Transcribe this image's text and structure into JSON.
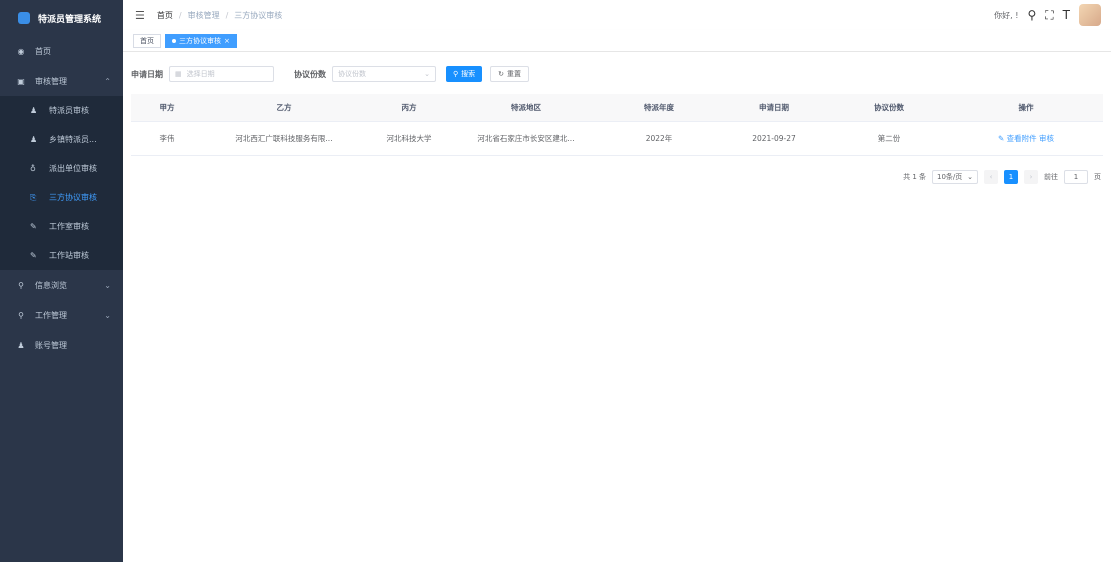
{
  "app": {
    "title": "特派员管理系统"
  },
  "sidebar": {
    "items": [
      {
        "label": "首页",
        "icon": "dashboard-icon"
      },
      {
        "label": "审核管理",
        "icon": "audit-icon",
        "arrow": "⌃"
      },
      {
        "label": "信息浏览",
        "icon": "browse-icon",
        "arrow": "⌄"
      },
      {
        "label": "工作管理",
        "icon": "work-icon",
        "arrow": "⌄"
      },
      {
        "label": "账号管理",
        "icon": "user-icon"
      }
    ],
    "sub_items": [
      {
        "label": "特派员审核",
        "icon": "user-icon"
      },
      {
        "label": "乡镇特派员...",
        "icon": "user-icon"
      },
      {
        "label": "派出单位审核",
        "icon": "org-icon"
      },
      {
        "label": "三方协议审核",
        "icon": "doc-icon"
      },
      {
        "label": "工作室审核",
        "icon": "edit-icon"
      },
      {
        "label": "工作站审核",
        "icon": "edit-icon"
      }
    ]
  },
  "header": {
    "breadcrumb": [
      "首页",
      "审核管理",
      "三方协议审核"
    ],
    "greeting": "你好, !"
  },
  "tags": {
    "home": "首页",
    "active": "三方协议审核"
  },
  "search": {
    "date_label": "申请日期",
    "date_placeholder": "选择日期",
    "copies_label": "协议份数",
    "copies_placeholder": "协议份数",
    "search_btn": "搜索",
    "reset_btn": "重置"
  },
  "table": {
    "headers": [
      "甲方",
      "乙方",
      "丙方",
      "特派地区",
      "特派年度",
      "申请日期",
      "协议份数",
      "操作"
    ],
    "rows": [
      {
        "party_a": "李伟",
        "party_b": "河北西汇广联科技服务有限...",
        "party_c": "河北科技大学",
        "region": "河北省石家庄市长安区建北...",
        "year": "2022年",
        "date": "2021-09-27",
        "copies": "第二份",
        "view": "查看附件",
        "audit": "审核"
      }
    ]
  },
  "pagination": {
    "total": "共 1 条",
    "page_size": "10条/页",
    "current": "1",
    "goto_label": "前往",
    "goto_value": "1",
    "page_suffix": "页"
  },
  "colors": {
    "sidebar_bg": "#2b3649",
    "accent": "#409eff",
    "primary_btn": "#1890ff"
  }
}
